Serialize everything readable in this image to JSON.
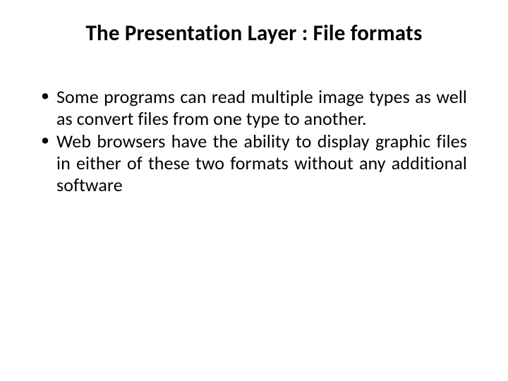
{
  "slide": {
    "title": "The Presentation Layer : File formats",
    "bullets": [
      "Some programs can read multiple image types as well as convert files from one type to another.",
      "Web browsers have the ability to display graphic files in either of these two formats without any additional software"
    ]
  }
}
